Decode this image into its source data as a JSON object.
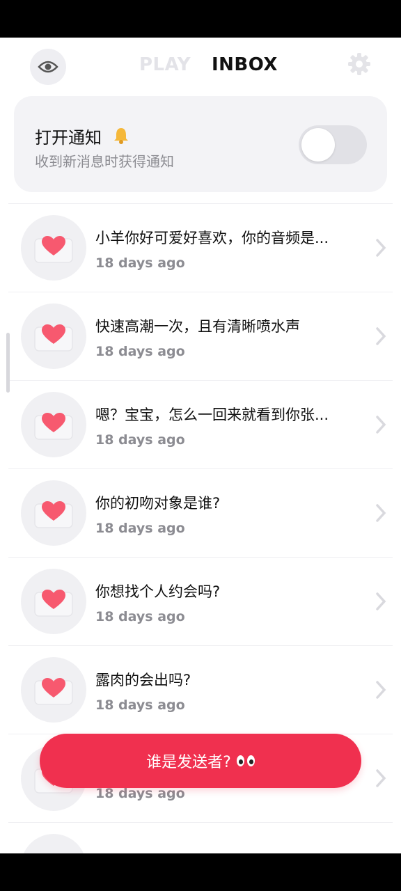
{
  "header": {
    "tab_play": "PLAY",
    "tab_inbox": "INBOX",
    "eye_icon": "eye-icon",
    "gear_icon": "gear-icon"
  },
  "notification": {
    "title": "打开通知",
    "subtitle": "收到新消息时获得通知",
    "toggle_on": false
  },
  "messages": [
    {
      "title": "小羊你好可爱好喜欢，你的音频是...",
      "time": "18 days ago"
    },
    {
      "title": "快速高潮一次，且有清晰喷水声",
      "time": "18 days ago"
    },
    {
      "title": "嗯？宝宝，怎么一回来就看到你张...",
      "time": "18 days ago"
    },
    {
      "title": "你的初吻对象是谁?",
      "time": "18 days ago"
    },
    {
      "title": "你想找个人约会吗?",
      "time": "18 days ago"
    },
    {
      "title": "露肉的会出吗?",
      "time": "18 days ago"
    },
    {
      "title": "",
      "time": "18 days ago"
    }
  ],
  "cta": {
    "label": "谁是发送者?"
  },
  "colors": {
    "accent": "#f0304f",
    "heart": "#f7596f"
  }
}
